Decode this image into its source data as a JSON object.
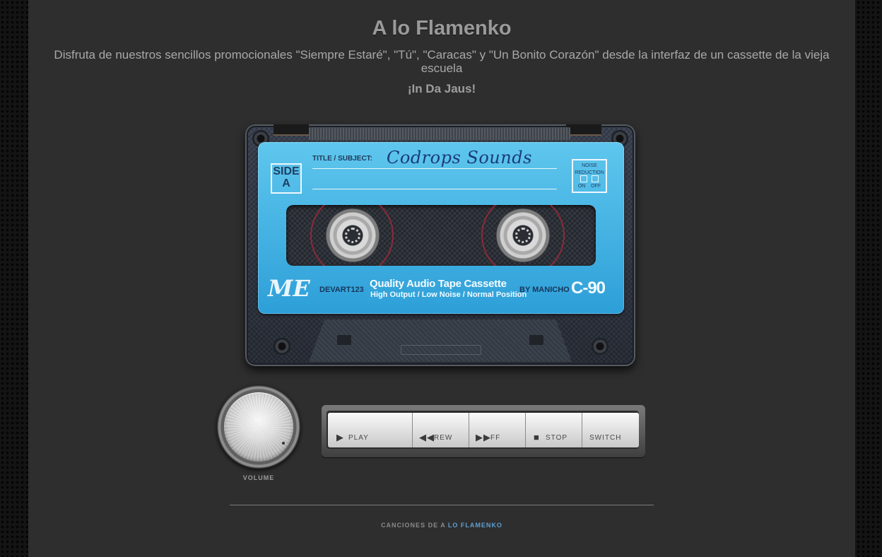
{
  "header": {
    "title": "A lo Flamenko",
    "subtitle": "Disfruta de nuestros sencillos promocionales \"Siempre Estaré\", \"Tú\", \"Caracas\" y \"Un Bonito Corazón\" desde la interfaz de un cassette de la vieja escuela",
    "tagline": "¡In Da Jaus!"
  },
  "cassette": {
    "side": [
      "SIDE",
      "A"
    ],
    "title_label": "TITLE / SUBJECT:",
    "title_value": "Codrops Sounds",
    "noise_reduction": {
      "lines": [
        "NOISE",
        "REDUCTION"
      ],
      "on": "ON",
      "off": "OFF"
    },
    "logo": "ME",
    "maker": "DEVART123",
    "product": "Quality Audio Tape Cassette",
    "product_sub": "High Output / Low Noise / Normal Position",
    "author": "BY MANICHO",
    "type": "C-90",
    "label_color": "#3bb3e6"
  },
  "volume": {
    "label": "VOLUME"
  },
  "controls": [
    {
      "name": "play",
      "label": "PLAY",
      "icon": "play-icon"
    },
    {
      "name": "rew",
      "label": "REW",
      "icon": "rewind-icon"
    },
    {
      "name": "ff",
      "label": "FF",
      "icon": "fast-forward-icon"
    },
    {
      "name": "stop",
      "label": "STOP",
      "icon": "stop-icon"
    },
    {
      "name": "switch",
      "label": "SWITCH",
      "icon": ""
    }
  ],
  "footer": {
    "prefix": "CANCIONES DE A",
    "accent": "LO FLAMENKO",
    "accent_color": "#5e9fd1"
  }
}
